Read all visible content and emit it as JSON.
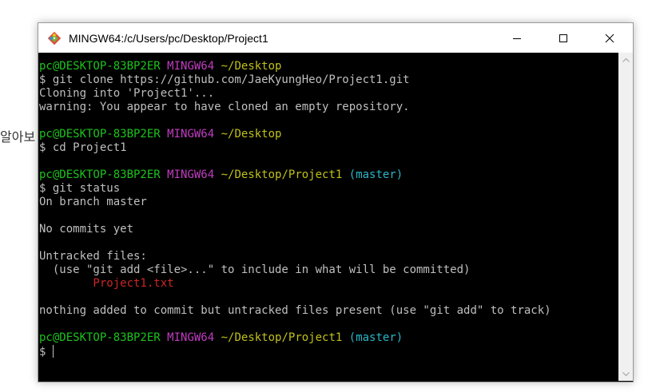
{
  "background": {
    "text": "알아보"
  },
  "window": {
    "title": "MINGW64:/c/Users/pc/Desktop/Project1",
    "icon": "git-logo-icon"
  },
  "colors": {
    "user_host": "#1cc31c",
    "mingw": "#c13cc1",
    "path": "#c0c01a",
    "branch": "#2ab6c8",
    "untracked_file": "#cc2626",
    "text": "#bfbfbf",
    "terminal_bg": "#000000"
  },
  "terminal": {
    "lines": [
      {
        "type": "prompt",
        "user": "pc@DESKTOP-83BP2ER",
        "system": "MINGW64",
        "path": "~/Desktop",
        "branch": ""
      },
      {
        "type": "text",
        "text": "$ git clone https://github.com/JaeKyungHeo/Project1.git"
      },
      {
        "type": "text",
        "text": "Cloning into 'Project1'..."
      },
      {
        "type": "text",
        "text": "warning: You appear to have cloned an empty repository."
      },
      {
        "type": "text",
        "text": ""
      },
      {
        "type": "prompt",
        "user": "pc@DESKTOP-83BP2ER",
        "system": "MINGW64",
        "path": "~/Desktop",
        "branch": ""
      },
      {
        "type": "text",
        "text": "$ cd Project1"
      },
      {
        "type": "text",
        "text": ""
      },
      {
        "type": "prompt",
        "user": "pc@DESKTOP-83BP2ER",
        "system": "MINGW64",
        "path": "~/Desktop/Project1",
        "branch": "(master)"
      },
      {
        "type": "text",
        "text": "$ git status"
      },
      {
        "type": "text",
        "text": "On branch master"
      },
      {
        "type": "text",
        "text": ""
      },
      {
        "type": "text",
        "text": "No commits yet"
      },
      {
        "type": "text",
        "text": ""
      },
      {
        "type": "text",
        "text": "Untracked files:"
      },
      {
        "type": "text",
        "text": "  (use \"git add <file>...\" to include in what will be committed)"
      },
      {
        "type": "untracked",
        "text": "        Project1.txt"
      },
      {
        "type": "text",
        "text": ""
      },
      {
        "type": "text",
        "text": "nothing added to commit but untracked files present (use \"git add\" to track)"
      },
      {
        "type": "text",
        "text": ""
      },
      {
        "type": "prompt",
        "user": "pc@DESKTOP-83BP2ER",
        "system": "MINGW64",
        "path": "~/Desktop/Project1",
        "branch": "(master)"
      },
      {
        "type": "input",
        "text": "$ "
      }
    ]
  }
}
